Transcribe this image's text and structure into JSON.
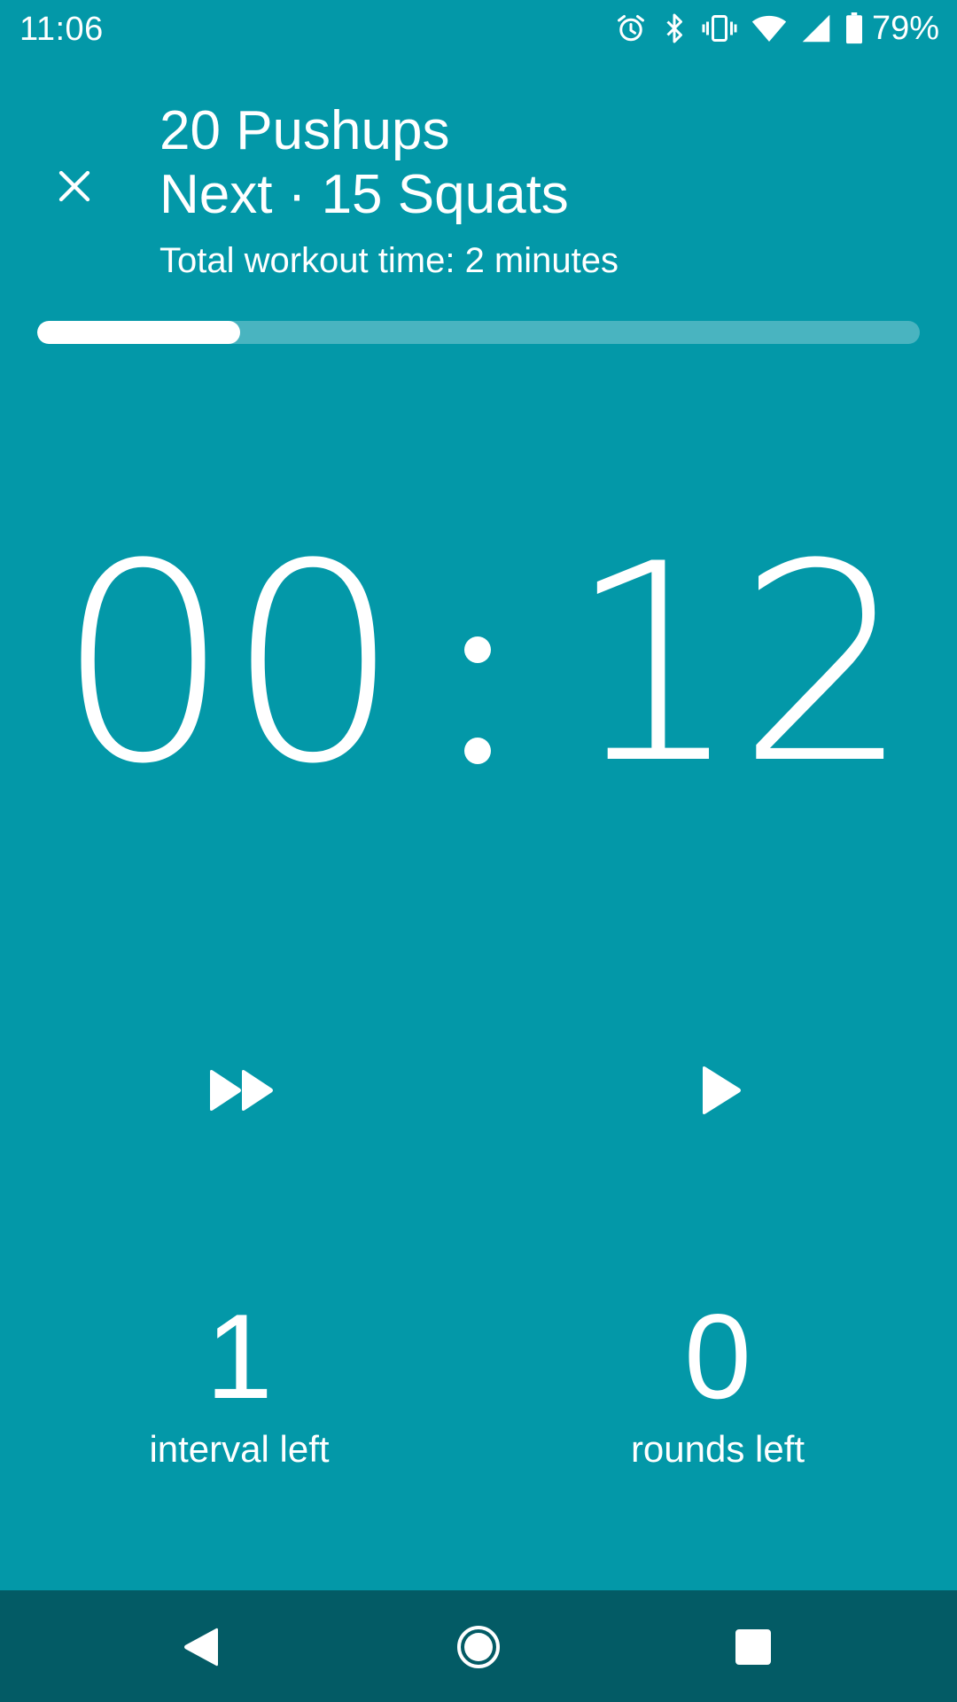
{
  "status_bar": {
    "time": "11:06",
    "battery_percent": "79%",
    "icons": [
      "alarm-icon",
      "bluetooth-icon",
      "vibrate-icon",
      "wifi-icon",
      "cell-signal-icon",
      "battery-icon"
    ]
  },
  "header": {
    "current_exercise": "20 Pushups",
    "next_exercise": "Next · 15 Squats",
    "total_time": "Total workout time: 2 minutes"
  },
  "progress": {
    "fraction": 0.23
  },
  "timer": {
    "minutes": "00",
    "seconds": "12"
  },
  "controls": {
    "skip_icon": "fast-forward-icon",
    "play_icon": "play-icon"
  },
  "counters": {
    "intervals_value": "1",
    "intervals_label": "interval left",
    "rounds_value": "0",
    "rounds_label": "rounds left"
  },
  "nav": {
    "icons": [
      "back-icon",
      "home-icon",
      "recents-icon"
    ]
  },
  "colors": {
    "background": "#0398a8",
    "nav_bar": "#035b65",
    "foreground": "#ffffff"
  }
}
